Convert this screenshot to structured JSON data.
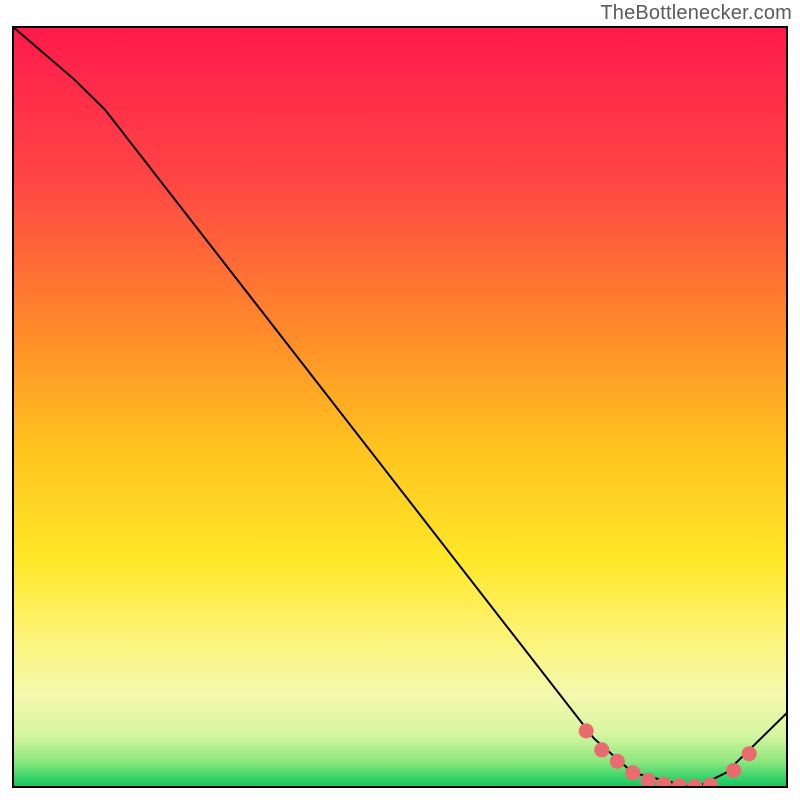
{
  "attribution": "TheBottlenecker.com",
  "chart_data": {
    "type": "line",
    "title": "",
    "xlabel": "",
    "ylabel": "",
    "xlim": [
      0,
      100
    ],
    "ylim": [
      0,
      100
    ],
    "series": [
      {
        "name": "curve",
        "x": [
          0,
          8,
          12,
          75,
          80,
          88,
          92,
          100
        ],
        "values": [
          100,
          93,
          89,
          6.5,
          2,
          0,
          2,
          10
        ]
      }
    ],
    "markers": {
      "name": "highlight-points",
      "color": "#e96a6f",
      "x": [
        74,
        76,
        78,
        80,
        82,
        84,
        86,
        88,
        90,
        93,
        95
      ],
      "values": [
        7.5,
        5,
        3.5,
        2,
        1,
        0.5,
        0.3,
        0.2,
        0.4,
        2.3,
        4.5
      ]
    },
    "gradient_stops": [
      {
        "offset": 0.0,
        "color": "#ff1a4b"
      },
      {
        "offset": 0.2,
        "color": "#ff4545"
      },
      {
        "offset": 0.4,
        "color": "#ff8a2a"
      },
      {
        "offset": 0.55,
        "color": "#ffc21f"
      },
      {
        "offset": 0.7,
        "color": "#ffe728"
      },
      {
        "offset": 0.8,
        "color": "#fdf476"
      },
      {
        "offset": 0.88,
        "color": "#f4f9b0"
      },
      {
        "offset": 0.93,
        "color": "#d6f5a0"
      },
      {
        "offset": 0.965,
        "color": "#8ee87f"
      },
      {
        "offset": 0.985,
        "color": "#3ed56b"
      },
      {
        "offset": 1.0,
        "color": "#12c45f"
      }
    ]
  }
}
